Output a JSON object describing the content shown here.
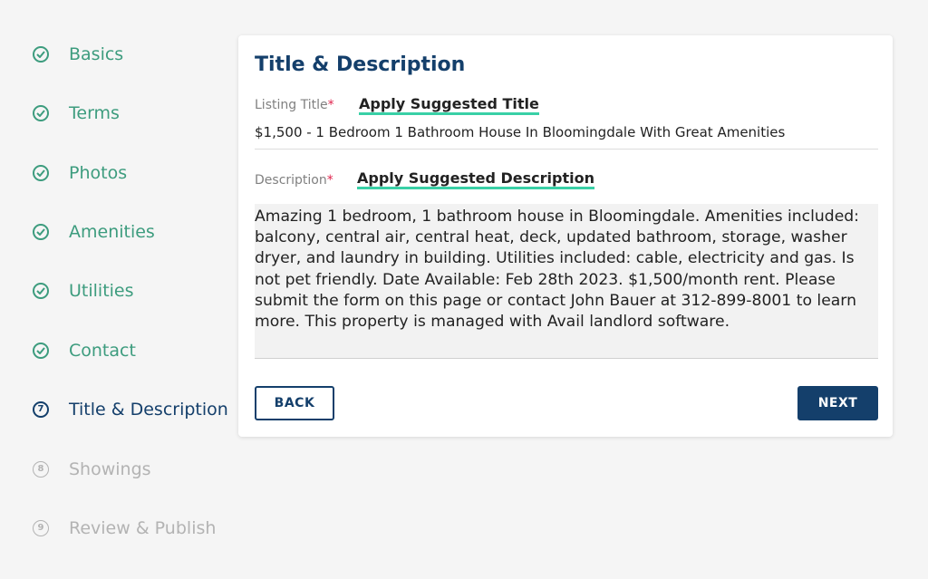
{
  "sidebar": {
    "steps": [
      {
        "label": "Basics",
        "state": "done"
      },
      {
        "label": "Terms",
        "state": "done"
      },
      {
        "label": "Photos",
        "state": "done"
      },
      {
        "label": "Amenities",
        "state": "done"
      },
      {
        "label": "Utilities",
        "state": "done"
      },
      {
        "label": "Contact",
        "state": "done"
      },
      {
        "label": "Title & Description",
        "state": "current",
        "number": "7"
      },
      {
        "label": "Showings",
        "state": "pending",
        "number": "8"
      },
      {
        "label": "Review & Publish",
        "state": "pending",
        "number": "9"
      }
    ]
  },
  "card": {
    "title": "Title & Description",
    "listing_title": {
      "label": "Listing Title",
      "required_mark": "*",
      "apply_link": "Apply Suggested Title",
      "value": "$1,500 - 1 Bedroom 1 Bathroom House In Bloomingdale With Great Amenities"
    },
    "description": {
      "label": "Description",
      "required_mark": "*",
      "apply_link": "Apply Suggested Description",
      "value": "Amazing 1 bedroom, 1 bathroom house in Bloomingdale. Amenities included: balcony, central air, central heat, deck, updated bathroom, storage, washer dryer, and laundry in building. Utilities included: cable, electricity and gas. Is not pet friendly. Date Available: Feb 28th 2023. $1,500/month rent. Please submit the form on this page or contact John Bauer at 312-899-8001 to learn more. This property is managed with Avail landlord software."
    },
    "back_label": "BACK",
    "next_label": "NEXT"
  },
  "colors": {
    "done": "#3d9c7e",
    "current": "#143f6b",
    "pending": "#b3b3b3",
    "accent_underline": "#39d0a6",
    "required": "#e0244d"
  },
  "icons": {
    "done": "check-circle-icon",
    "numbered": "numbered-circle-icon"
  }
}
